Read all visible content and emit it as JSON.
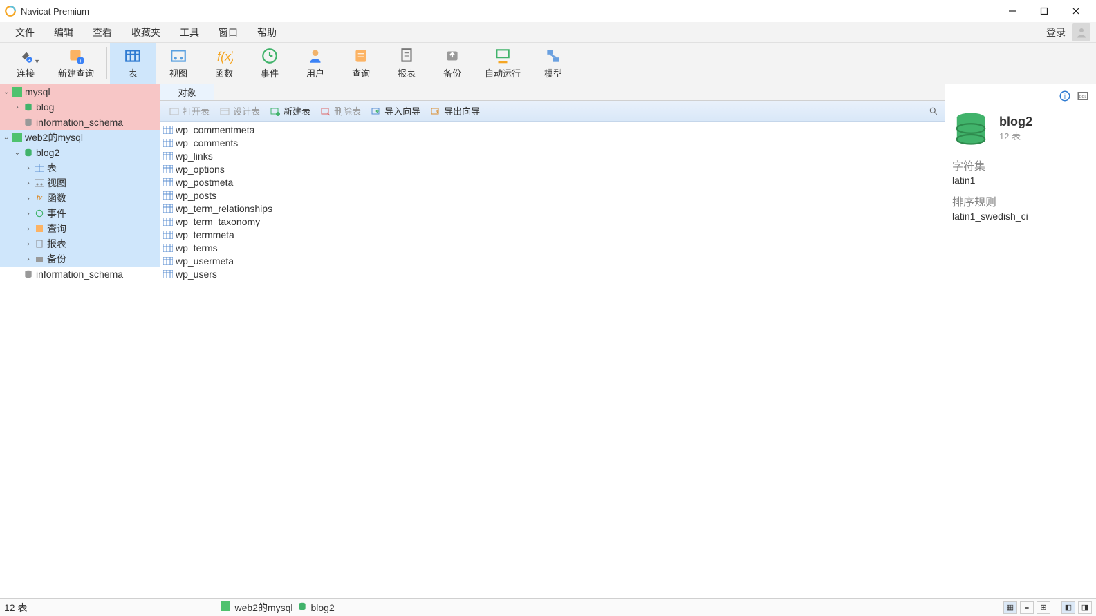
{
  "app_title": "Navicat Premium",
  "menubar": {
    "items": [
      "文件",
      "编辑",
      "查看",
      "收藏夹",
      "工具",
      "窗口",
      "帮助"
    ],
    "login": "登录"
  },
  "toolbar": {
    "connect": "连接",
    "new_query": "新建查询",
    "table": "表",
    "view": "视图",
    "function": "函数",
    "event": "事件",
    "user": "用户",
    "query": "查询",
    "report": "报表",
    "backup": "备份",
    "autorun": "自动运行",
    "model": "模型"
  },
  "sidebar": {
    "conn1": "mysql",
    "conn1_dbs": [
      "blog",
      "information_schema"
    ],
    "conn2": "web2的mysql",
    "conn2_db1": "blog2",
    "conn2_db1_children": [
      "表",
      "视图",
      "函数",
      "事件",
      "查询",
      "报表",
      "备份"
    ],
    "conn2_db2": "information_schema"
  },
  "center": {
    "tab_object": "对象",
    "subtoolbar": {
      "open_table": "打开表",
      "design_table": "设计表",
      "new_table": "新建表",
      "delete_table": "删除表",
      "import_wizard": "导入向导",
      "export_wizard": "导出向导"
    },
    "tables": [
      "wp_commentmeta",
      "wp_comments",
      "wp_links",
      "wp_options",
      "wp_postmeta",
      "wp_posts",
      "wp_term_relationships",
      "wp_term_taxonomy",
      "wp_termmeta",
      "wp_terms",
      "wp_usermeta",
      "wp_users"
    ]
  },
  "rightpanel": {
    "db_name": "blog2",
    "table_count": "12 表",
    "charset_label": "字符集",
    "charset_value": "latin1",
    "collation_label": "排序规则",
    "collation_value": "latin1_swedish_ci"
  },
  "statusbar": {
    "count": "12 表",
    "path_conn": "web2的mysql",
    "path_db": "blog2"
  }
}
